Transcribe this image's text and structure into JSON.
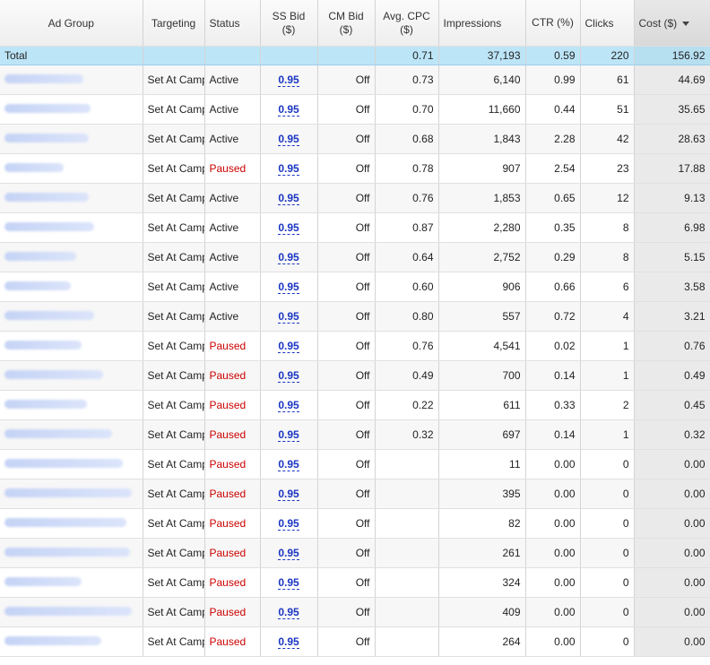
{
  "columns": {
    "ad_group": "Ad Group",
    "targeting": "Targeting",
    "status": "Status",
    "ss_bid": "SS Bid ($)",
    "cm_bid": "CM Bid ($)",
    "avg_cpc": "Avg. CPC ($)",
    "impressions": "Impressions",
    "ctr": "CTR (%)",
    "clicks": "Clicks",
    "cost": "Cost ($)"
  },
  "total": {
    "label": "Total",
    "avg_cpc": "0.71",
    "impressions": "37,193",
    "ctr": "0.59",
    "clicks": "220",
    "cost": "156.92"
  },
  "rows": [
    {
      "targeting": "Set At Campaign",
      "status": "Active",
      "ss_bid": "0.95",
      "cm_bid": "Off",
      "avg_cpc": "0.73",
      "impressions": "6,140",
      "ctr": "0.99",
      "clicks": "61",
      "cost": "44.69"
    },
    {
      "targeting": "Set At Campaign",
      "status": "Active",
      "ss_bid": "0.95",
      "cm_bid": "Off",
      "avg_cpc": "0.70",
      "impressions": "11,660",
      "ctr": "0.44",
      "clicks": "51",
      "cost": "35.65"
    },
    {
      "targeting": "Set At Campaign",
      "status": "Active",
      "ss_bid": "0.95",
      "cm_bid": "Off",
      "avg_cpc": "0.68",
      "impressions": "1,843",
      "ctr": "2.28",
      "clicks": "42",
      "cost": "28.63"
    },
    {
      "targeting": "Set At Campaign",
      "status": "Paused",
      "ss_bid": "0.95",
      "cm_bid": "Off",
      "avg_cpc": "0.78",
      "impressions": "907",
      "ctr": "2.54",
      "clicks": "23",
      "cost": "17.88"
    },
    {
      "targeting": "Set At Campaign",
      "status": "Active",
      "ss_bid": "0.95",
      "cm_bid": "Off",
      "avg_cpc": "0.76",
      "impressions": "1,853",
      "ctr": "0.65",
      "clicks": "12",
      "cost": "9.13"
    },
    {
      "targeting": "Set At Campaign",
      "status": "Active",
      "ss_bid": "0.95",
      "cm_bid": "Off",
      "avg_cpc": "0.87",
      "impressions": "2,280",
      "ctr": "0.35",
      "clicks": "8",
      "cost": "6.98"
    },
    {
      "targeting": "Set At Campaign",
      "status": "Active",
      "ss_bid": "0.95",
      "cm_bid": "Off",
      "avg_cpc": "0.64",
      "impressions": "2,752",
      "ctr": "0.29",
      "clicks": "8",
      "cost": "5.15"
    },
    {
      "targeting": "Set At Campaign",
      "status": "Active",
      "ss_bid": "0.95",
      "cm_bid": "Off",
      "avg_cpc": "0.60",
      "impressions": "906",
      "ctr": "0.66",
      "clicks": "6",
      "cost": "3.58"
    },
    {
      "targeting": "Set At Campaign",
      "status": "Active",
      "ss_bid": "0.95",
      "cm_bid": "Off",
      "avg_cpc": "0.80",
      "impressions": "557",
      "ctr": "0.72",
      "clicks": "4",
      "cost": "3.21"
    },
    {
      "targeting": "Set At Campaign",
      "status": "Paused",
      "ss_bid": "0.95",
      "cm_bid": "Off",
      "avg_cpc": "0.76",
      "impressions": "4,541",
      "ctr": "0.02",
      "clicks": "1",
      "cost": "0.76"
    },
    {
      "targeting": "Set At Campaign",
      "status": "Paused",
      "ss_bid": "0.95",
      "cm_bid": "Off",
      "avg_cpc": "0.49",
      "impressions": "700",
      "ctr": "0.14",
      "clicks": "1",
      "cost": "0.49"
    },
    {
      "targeting": "Set At Campaign",
      "status": "Paused",
      "ss_bid": "0.95",
      "cm_bid": "Off",
      "avg_cpc": "0.22",
      "impressions": "611",
      "ctr": "0.33",
      "clicks": "2",
      "cost": "0.45"
    },
    {
      "targeting": "Set At Campaign",
      "status": "Paused",
      "ss_bid": "0.95",
      "cm_bid": "Off",
      "avg_cpc": "0.32",
      "impressions": "697",
      "ctr": "0.14",
      "clicks": "1",
      "cost": "0.32"
    },
    {
      "targeting": "Set At Campaign",
      "status": "Paused",
      "ss_bid": "0.95",
      "cm_bid": "Off",
      "avg_cpc": "",
      "impressions": "11",
      "ctr": "0.00",
      "clicks": "0",
      "cost": "0.00"
    },
    {
      "targeting": "Set At Campaign",
      "status": "Paused",
      "ss_bid": "0.95",
      "cm_bid": "Off",
      "avg_cpc": "",
      "impressions": "395",
      "ctr": "0.00",
      "clicks": "0",
      "cost": "0.00"
    },
    {
      "targeting": "Set At Campaign",
      "status": "Paused",
      "ss_bid": "0.95",
      "cm_bid": "Off",
      "avg_cpc": "",
      "impressions": "82",
      "ctr": "0.00",
      "clicks": "0",
      "cost": "0.00"
    },
    {
      "targeting": "Set At Campaign",
      "status": "Paused",
      "ss_bid": "0.95",
      "cm_bid": "Off",
      "avg_cpc": "",
      "impressions": "261",
      "ctr": "0.00",
      "clicks": "0",
      "cost": "0.00"
    },
    {
      "targeting": "Set At Campaign",
      "status": "Paused",
      "ss_bid": "0.95",
      "cm_bid": "Off",
      "avg_cpc": "",
      "impressions": "324",
      "ctr": "0.00",
      "clicks": "0",
      "cost": "0.00"
    },
    {
      "targeting": "Set At Campaign",
      "status": "Paused",
      "ss_bid": "0.95",
      "cm_bid": "Off",
      "avg_cpc": "",
      "impressions": "409",
      "ctr": "0.00",
      "clicks": "0",
      "cost": "0.00"
    },
    {
      "targeting": "Set At Campaign",
      "status": "Paused",
      "ss_bid": "0.95",
      "cm_bid": "Off",
      "avg_cpc": "",
      "impressions": "264",
      "ctr": "0.00",
      "clicks": "0",
      "cost": "0.00"
    }
  ],
  "colors": {
    "total_row_bg": "#bde5f8",
    "paused_status": "#cc0000",
    "bid_link": "#1a35c2"
  },
  "icons": {
    "sort": "sort-desc-icon"
  }
}
